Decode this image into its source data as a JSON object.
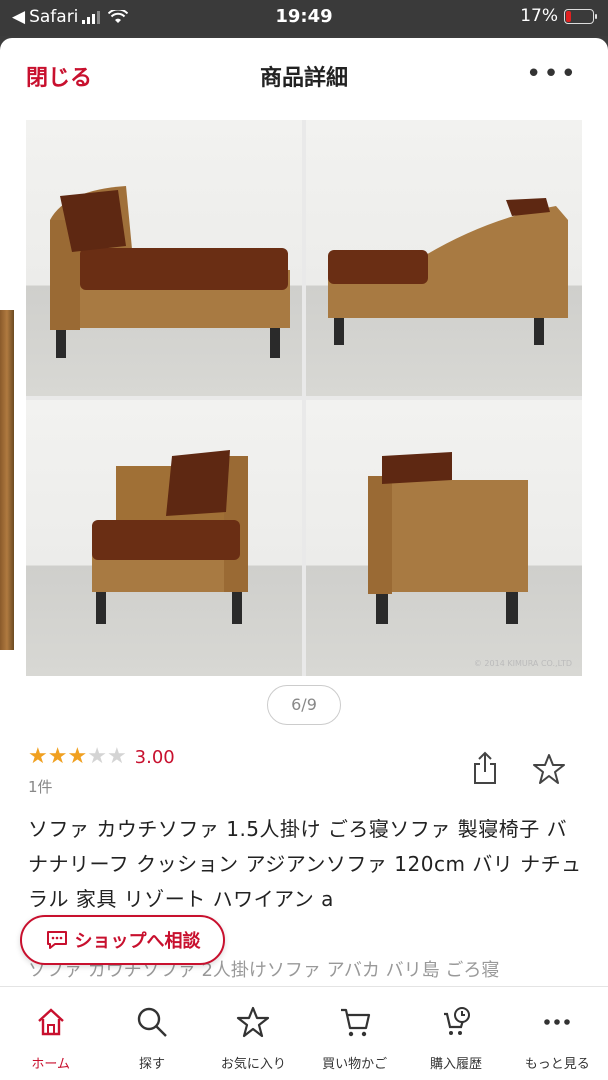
{
  "status_bar": {
    "carrier": "Safari",
    "time": "19:49",
    "battery": "17%",
    "battery_level": 0.17
  },
  "header": {
    "close_label": "閉じる",
    "title": "商品詳細",
    "more_label": "•••"
  },
  "gallery": {
    "pager": "6/9",
    "copyright": "© 2014 KIMURA CO.,LTD"
  },
  "rating": {
    "stars_filled": 3,
    "stars_total": 5,
    "score": "3.00",
    "count": "1件"
  },
  "product": {
    "title": "ソファ カウチソファ 1.5人掛け ごろ寝ソファ 製寝椅子 バナナリーフ クッション アジアンソファ 120cm バリ ナチュラル 家具 リゾート ハワイアン a",
    "subtitle": "ソファ カウチソファ 2人掛けソファ アバカ バリ島 ごろ寝"
  },
  "shop_button": {
    "label": "ショップへ相談"
  },
  "bottom_nav": {
    "items": [
      {
        "label": "ホーム",
        "icon": "home-icon"
      },
      {
        "label": "探す",
        "icon": "search-icon"
      },
      {
        "label": "お気に入り",
        "icon": "star-icon"
      },
      {
        "label": "買い物かご",
        "icon": "cart-icon"
      },
      {
        "label": "購入履歴",
        "icon": "history-icon"
      },
      {
        "label": "もっと見る",
        "icon": "more-icon"
      }
    ]
  },
  "colors": {
    "accent": "#c8102e",
    "star_on": "#f0a020",
    "star_off": "#d4d4d4"
  }
}
